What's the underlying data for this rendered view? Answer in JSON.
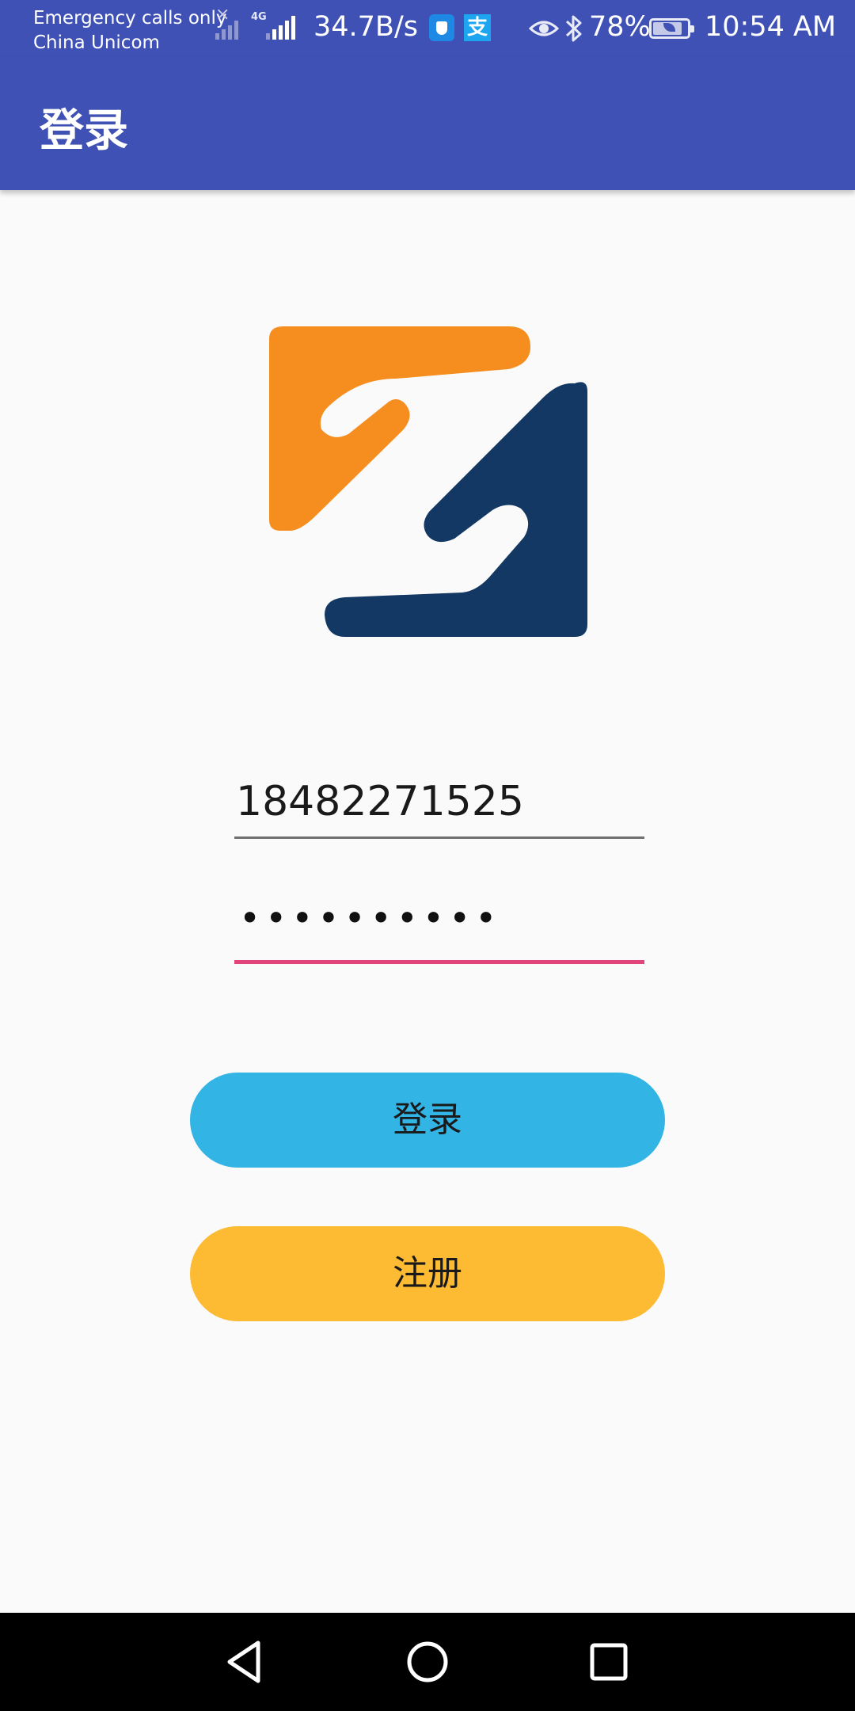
{
  "status_bar": {
    "carrier_line1": "Emergency calls only",
    "carrier_line2": "China Unicom",
    "network_type": "4G",
    "net_speed": "34.7B/s",
    "battery_percent": "78%",
    "time": "10:54 AM",
    "icons": [
      "signal-x-icon",
      "signal-bars-icon",
      "lte-signal-icon",
      "security-shield-icon",
      "alipay-icon",
      "eye-comfort-icon",
      "bluetooth-icon",
      "battery-icon"
    ]
  },
  "app_bar": {
    "title": "登录"
  },
  "logo": {
    "colors": {
      "orange": "#f58d1f",
      "navy": "#133863"
    }
  },
  "form": {
    "phone": {
      "value": "18482271525"
    },
    "password": {
      "value": "••••••••••"
    }
  },
  "buttons": {
    "login_label": "登录",
    "register_label": "注册"
  },
  "colors": {
    "primary": "#3f51b5",
    "accent": "#e0457b",
    "login_button": "#32b4e5",
    "register_button": "#fdba33"
  },
  "nav_bar": {
    "icons": [
      "back-icon",
      "home-icon",
      "recents-icon"
    ]
  }
}
